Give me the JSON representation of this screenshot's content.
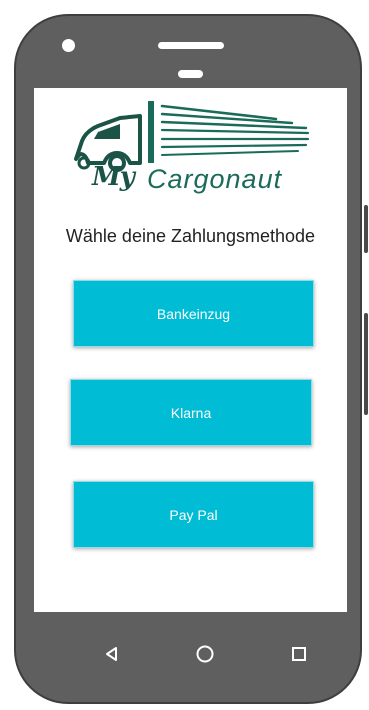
{
  "logo": {
    "prefix": "My",
    "name": "Cargonaut",
    "colors": {
      "primary": "#1b6b5b",
      "dark": "#1b5447"
    }
  },
  "heading": "Wähle deine Zahlungsmethode",
  "payment_methods": [
    {
      "label": "Bankeinzug"
    },
    {
      "label": "Klarna"
    },
    {
      "label": "Pay Pal"
    }
  ],
  "theme": {
    "button_color": "#00bcd4",
    "button_text_color": "#ffffff",
    "frame_color": "#5f5f5f"
  },
  "nav": {
    "icons": [
      "back-triangle-icon",
      "home-circle-icon",
      "recents-square-icon"
    ]
  }
}
